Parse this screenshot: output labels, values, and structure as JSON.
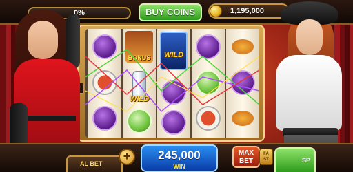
{
  "header": {
    "level_progress": "0%",
    "buy_coins_label": "BUY COINS",
    "coin_balance": "1,195,000"
  },
  "reels": {
    "lines_count": "30",
    "columns": [
      {
        "symbols": [
          "purple-broom",
          "red-plate",
          "purple-broom"
        ]
      },
      {
        "symbols": [
          "monkey-bonus",
          "wild-bottle",
          "green-plate"
        ],
        "bonus_label": "BONUS",
        "wild_label": "WILD"
      },
      {
        "symbols": [
          "wild-bottle",
          "purple-ball"
        ],
        "wild_label": "WILD"
      },
      {
        "symbols": [
          "purple-ball",
          "green-broom",
          "red-plate"
        ]
      },
      {
        "symbols": [
          "orange-food",
          "purple-broom",
          "orange-food"
        ]
      }
    ]
  },
  "footer": {
    "total_bet_label": "AL BET",
    "win_value": "245,000",
    "win_label": "WIN",
    "max_bet_line1": "MAX",
    "max_bet_line2": "BET",
    "fast_line1": "FA",
    "fast_line2": "ST",
    "spin_label": "SP"
  },
  "colors": {
    "buy_coins_green": "#2e9b1c",
    "win_blue": "#0a3ca8",
    "frame_gold": "#c8963c",
    "dress_red": "#e0141c"
  }
}
